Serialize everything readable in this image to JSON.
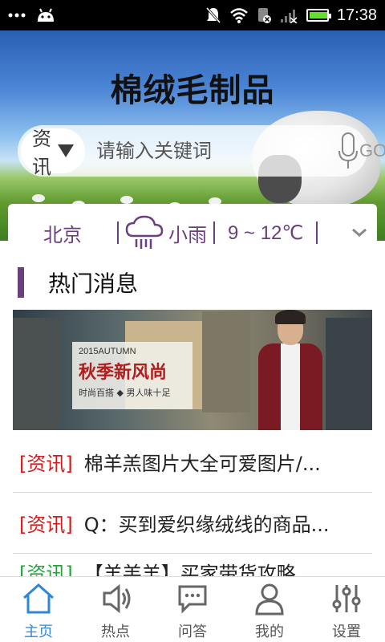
{
  "status_bar": {
    "time": "17:38",
    "battery_level": 0.9
  },
  "header": {
    "title": "棉绒毛制品"
  },
  "search": {
    "category": "资讯",
    "placeholder": "请输入关键词",
    "go_label": "GO"
  },
  "weather": {
    "city": "北京",
    "condition": "小雨",
    "temperature": "9 ~ 12℃"
  },
  "hot_news": {
    "title": "热门消息",
    "banner": {
      "small": "2015AUTUMN",
      "headline": "秋季新风尚",
      "line1": "时尚百搭 ◆ 男人味十足"
    },
    "items": [
      {
        "tag": "[资讯]",
        "title": "棉羊羔图片大全可爱图片/..."
      },
      {
        "tag": "[资讯]",
        "title": "Q：买到爱织缘绒线的商品..."
      },
      {
        "tag": "[资讯]",
        "title": "【羊羔羊】买家带货攻略"
      }
    ]
  },
  "tabs": [
    {
      "label": "主页",
      "icon": "home-icon",
      "active": true
    },
    {
      "label": "热点",
      "icon": "speaker-icon",
      "active": false
    },
    {
      "label": "问答",
      "icon": "chat-icon",
      "active": false
    },
    {
      "label": "我的",
      "icon": "user-icon",
      "active": false
    },
    {
      "label": "设置",
      "icon": "sliders-icon",
      "active": false
    }
  ],
  "colors": {
    "accent": "#2f86d8",
    "tag_red": "#d21a1a",
    "section_purple": "#6a3f7c"
  }
}
